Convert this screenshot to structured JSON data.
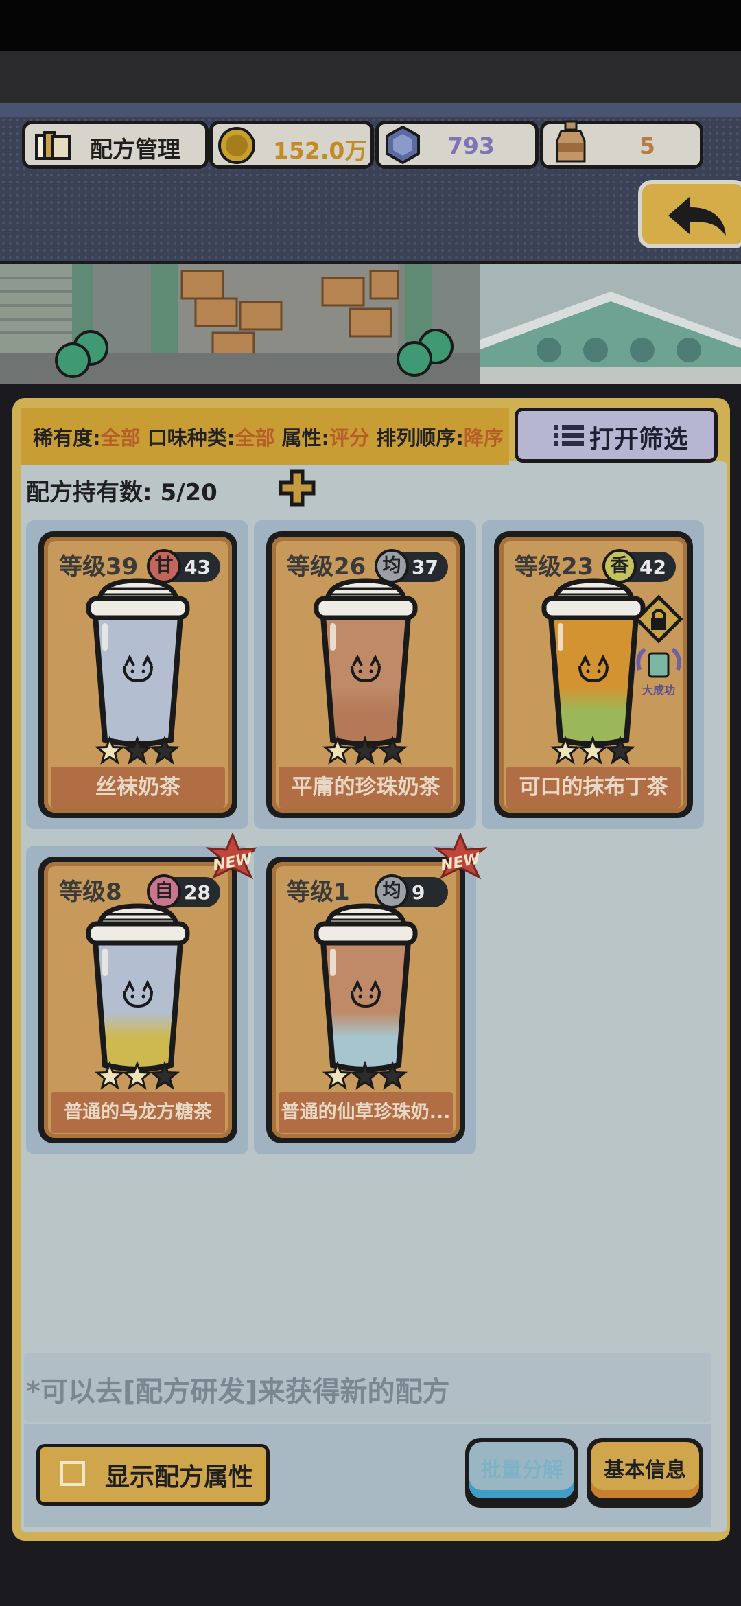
{
  "header": {
    "title": "配方管理",
    "coins": "152.0万",
    "gems": "793",
    "bottles": "5"
  },
  "filter": {
    "rarity_label": "稀有度:",
    "rarity_value": "全部",
    "flavor_label": "口味种类:",
    "flavor_value": "全部",
    "attr_label": "属性:",
    "attr_value": "评分",
    "order_label": "排列顺序:",
    "order_value": "降序",
    "open_filter_label": "打开筛选"
  },
  "owned": {
    "label": "配方持有数:",
    "value": "5/20"
  },
  "cards": [
    {
      "level": "等级39",
      "flavor": "甘",
      "score": "43",
      "name": "丝袜奶茶",
      "stars": 1,
      "is_new": false,
      "locked": false,
      "cup_top": "#b3bfd0",
      "cup_bottom": "#b3bfd0",
      "flavor_color": "#c0665c"
    },
    {
      "level": "等级26",
      "flavor": "均",
      "score": "37",
      "name": "平庸的珍珠奶茶",
      "stars": 1,
      "is_new": false,
      "locked": false,
      "cup_top": "#c08a68",
      "cup_bottom": "#b47a58",
      "flavor_color": "#9aa0a6"
    },
    {
      "level": "等级23",
      "flavor": "香",
      "score": "42",
      "name": "可口的抹布丁茶",
      "stars": 2,
      "is_new": false,
      "locked": true,
      "lock_caption": "大成功",
      "cup_top": "#d49331",
      "cup_bottom": "#9ab85a",
      "flavor_color": "#c4c25c"
    },
    {
      "level": "等级8",
      "flavor": "自",
      "score": "28",
      "name": "普通的乌龙方糖茶",
      "stars": 2,
      "is_new": true,
      "new_label": "NEW",
      "locked": false,
      "cup_top": "#b3bfd0",
      "cup_bottom": "#cdb94f",
      "flavor_color": "#c9758c"
    },
    {
      "level": "等级1",
      "flavor": "均",
      "score": "9",
      "name": "普通的仙草珍珠奶...",
      "stars": 1,
      "is_new": true,
      "new_label": "NEW",
      "locked": false,
      "cup_top": "#c08a68",
      "cup_bottom": "#a7c5cf",
      "flavor_color": "#9aa0a6"
    }
  ],
  "hint": "*可以去[配方研发]来获得新的配方",
  "buttons": {
    "show_attr": "显示配方属性",
    "batch": "批量分解",
    "basic": "基本信息"
  },
  "colors": {
    "accent_gold": "#d0a64c",
    "panel_blue": "#bac5c8",
    "highlight_orange": "#b65d2a"
  }
}
